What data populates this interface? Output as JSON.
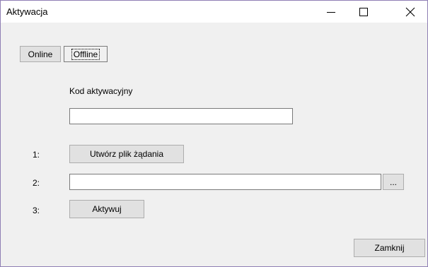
{
  "window": {
    "title": "Aktywacja",
    "controls": {
      "minimize": "—",
      "maximize": "☐",
      "close": "✕"
    }
  },
  "tabs": [
    {
      "label": "Online",
      "selected": false
    },
    {
      "label": "Offline",
      "selected": true
    }
  ],
  "form": {
    "code_label": "Kod aktywacyjny",
    "code_value": "",
    "steps": [
      {
        "number": "1:",
        "button_label": "Utwórz plik żądania"
      },
      {
        "number": "2:",
        "file_value": "",
        "browse_label": "..."
      },
      {
        "number": "3:",
        "button_label": "Aktywuj"
      }
    ]
  },
  "footer": {
    "close_label": "Zamknij"
  }
}
